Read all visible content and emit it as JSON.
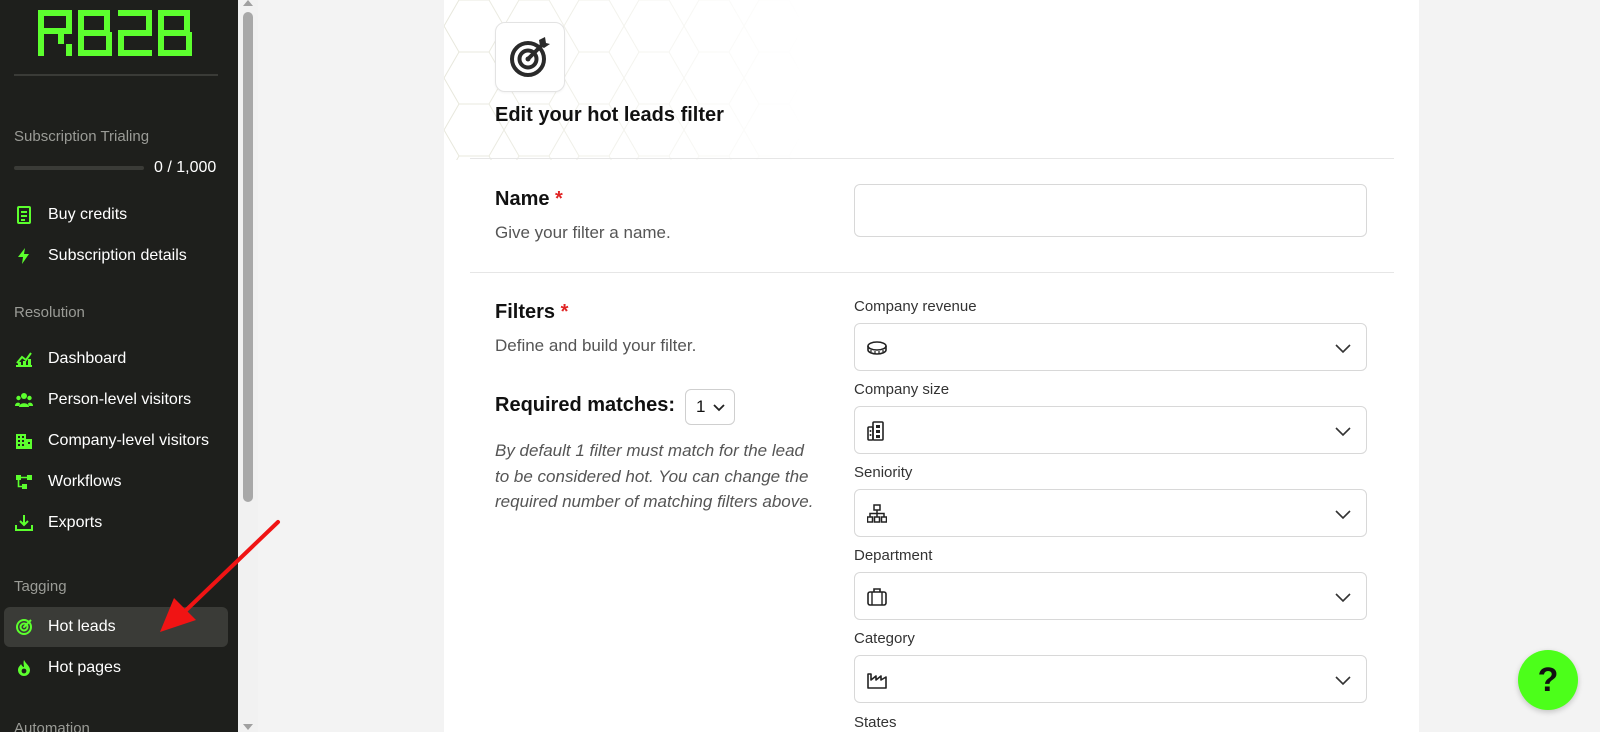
{
  "sidebar": {
    "logo_text": "RB2B",
    "subscription": {
      "label": "Subscription Trialing",
      "count": "0 / 1,000",
      "progress": 0
    },
    "sections": {
      "resolution": "Resolution",
      "tagging": "Tagging",
      "automation": "Automation"
    },
    "items": [
      {
        "label": "Buy credits",
        "icon": "receipt-icon"
      },
      {
        "label": "Subscription details",
        "icon": "bolt-icon"
      },
      {
        "label": "Dashboard",
        "icon": "chart-icon"
      },
      {
        "label": "Person-level visitors",
        "icon": "users-icon"
      },
      {
        "label": "Company-level visitors",
        "icon": "building-icon"
      },
      {
        "label": "Workflows",
        "icon": "workflow-icon"
      },
      {
        "label": "Exports",
        "icon": "download-icon"
      },
      {
        "label": "Hot leads",
        "icon": "target-icon",
        "active": true
      },
      {
        "label": "Hot pages",
        "icon": "flame-icon"
      }
    ],
    "accent": "#5cff2e"
  },
  "form": {
    "title": "Edit your hot leads filter",
    "name": {
      "label": "Name",
      "required": "*",
      "help": "Give your filter a name.",
      "value": ""
    },
    "filters": {
      "label": "Filters",
      "required": "*",
      "help": "Define and build your filter."
    },
    "required_matches": {
      "label": "Required matches:",
      "value": "1",
      "note": "By default 1 filter must match for the lead to be considered hot. You can change the required number of matching filters above."
    },
    "filter_fields": [
      {
        "label": "Company revenue",
        "icon": "coins-icon"
      },
      {
        "label": "Company size",
        "icon": "office-building-icon"
      },
      {
        "label": "Seniority",
        "icon": "hierarchy-icon"
      },
      {
        "label": "Department",
        "icon": "briefcase-icon"
      },
      {
        "label": "Category",
        "icon": "factory-icon"
      },
      {
        "label": "States",
        "icon": ""
      }
    ]
  },
  "help_button": {
    "label": "?",
    "color": "#4cff1a"
  }
}
